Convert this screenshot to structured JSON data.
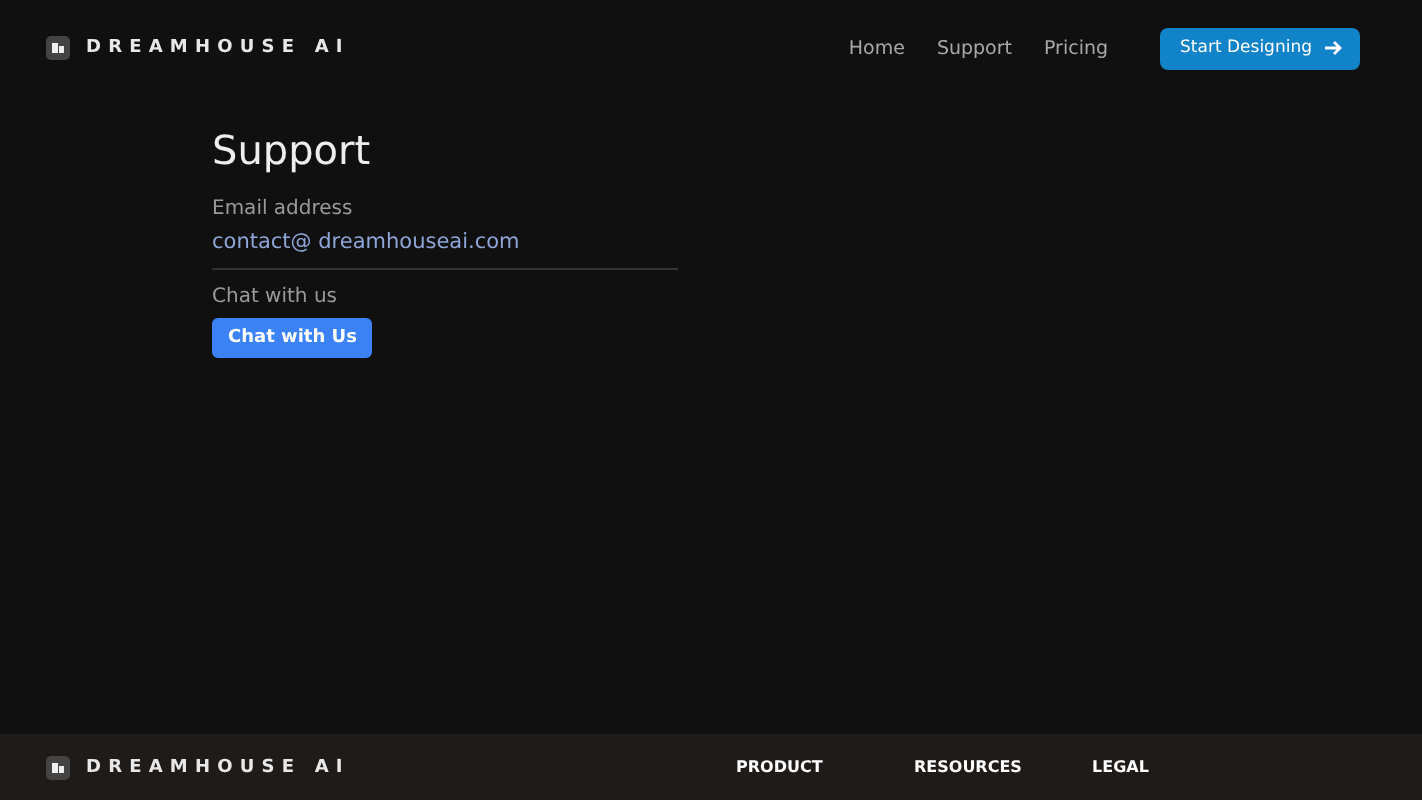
{
  "header": {
    "brand": "DREAMHOUSE AI",
    "nav": [
      {
        "label": "Home"
      },
      {
        "label": "Support"
      },
      {
        "label": "Pricing"
      }
    ],
    "cta": "Start Designing"
  },
  "support": {
    "title": "Support",
    "email_label": "Email address",
    "email": "contact@ dreamhouseai.com",
    "chat_label": "Chat with us",
    "chat_button": "Chat with Us"
  },
  "footer": {
    "brand": "DREAMHOUSE AI",
    "columns": [
      "PRODUCT",
      "RESOURCES",
      "LEGAL"
    ]
  }
}
